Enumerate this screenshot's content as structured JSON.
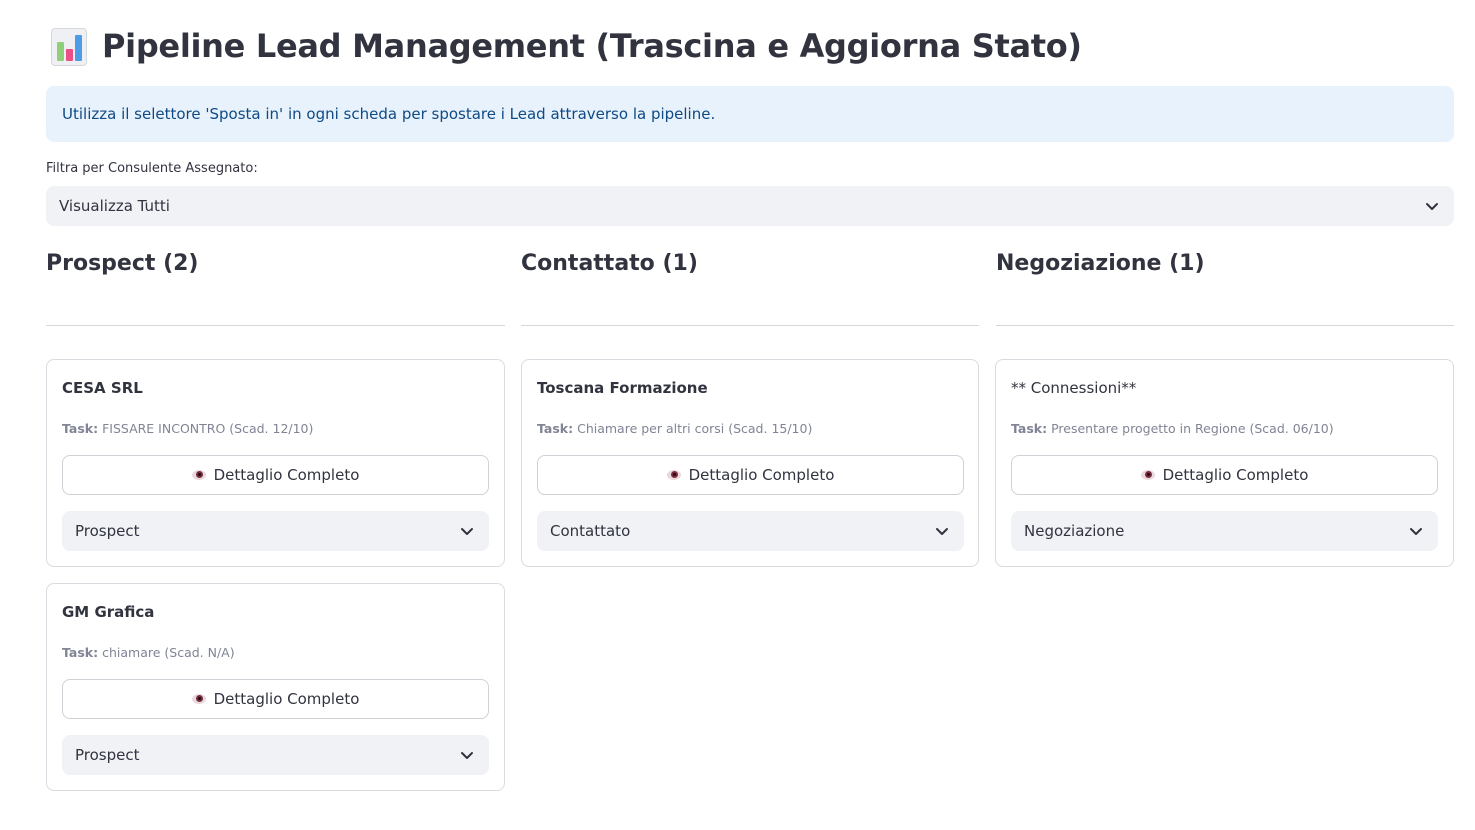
{
  "page": {
    "title": "Pipeline Lead Management (Trascina e Aggiorna Stato)",
    "title_icon": "bar-chart-emoji",
    "info": "Utilizza il selettore 'Sposta in' in ogni scheda per spostare i Lead attraverso la pipeline."
  },
  "filter": {
    "label": "Filtra per Consulente Assegnato:",
    "value": "Visualizza Tutti"
  },
  "columns": [
    {
      "header": "Prospect (2)"
    },
    {
      "header": "Contattato (1)"
    },
    {
      "header": "Negoziazione (1)"
    }
  ],
  "cards": [
    {
      "name": "CESA SRL",
      "task_label": "Task:",
      "task": "FISSARE INCONTRO (Scad. 12/10)",
      "detail_label": "Dettaglio Completo",
      "stage": "Prospect"
    },
    {
      "name": "GM Grafica",
      "task_label": "Task:",
      "task": "chiamare (Scad. N/A)",
      "detail_label": "Dettaglio Completo",
      "stage": "Prospect"
    },
    {
      "name": "Toscana Formazione",
      "task_label": "Task:",
      "task": "Chiamare per altri corsi (Scad. 15/10)",
      "detail_label": "Dettaglio Completo",
      "stage": "Contattato"
    },
    {
      "name": "** Connessioni**",
      "task_label": "Task:",
      "task": "Presentare progetto in Regione (Scad. 06/10)",
      "detail_label": "Dettaglio Completo",
      "stage": "Negoziazione"
    }
  ],
  "colors": {
    "info_bg": "#e8f2fc",
    "info_text": "#0f4a84",
    "select_bg": "#f0f2f6",
    "text": "#31333f",
    "muted": "#808495"
  },
  "icons": {
    "select_chevron": "chevron-down-icon",
    "detail": "eye-icon"
  }
}
